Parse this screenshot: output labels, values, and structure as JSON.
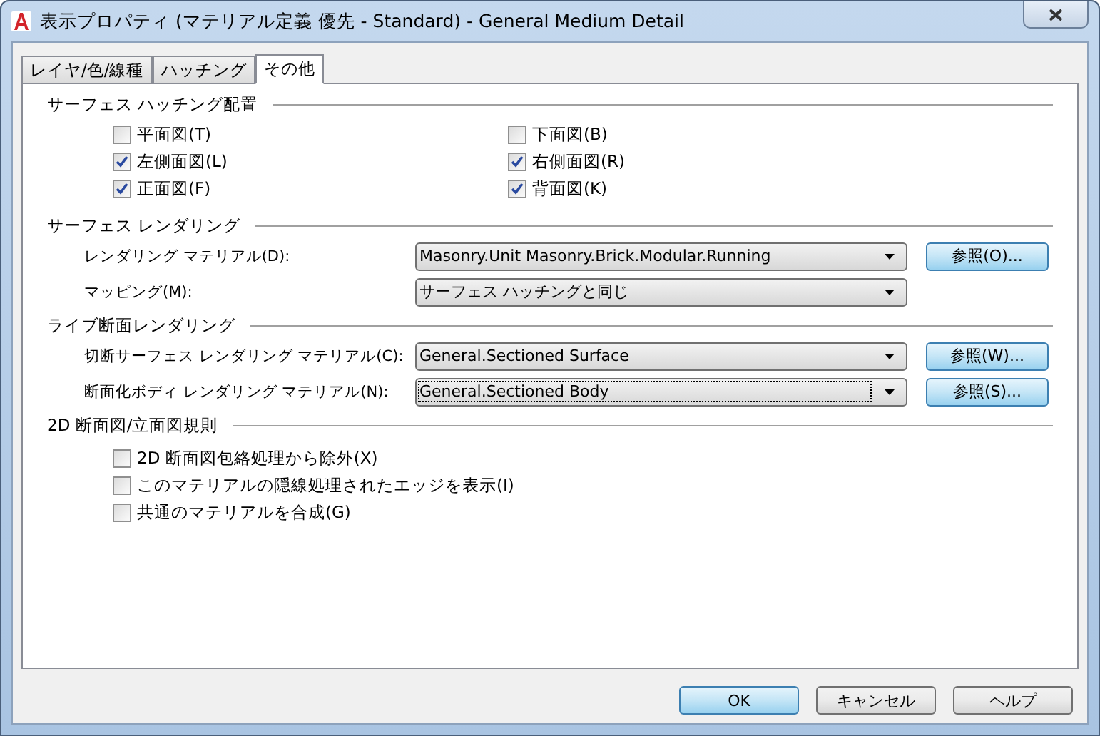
{
  "window": {
    "title": "表示プロパティ (マテリアル定義 優先 - Standard) - General Medium Detail"
  },
  "tabs": [
    {
      "label": "レイヤ/色/線種",
      "selected": false
    },
    {
      "label": "ハッチング",
      "selected": false
    },
    {
      "label": "その他",
      "selected": true
    }
  ],
  "sections": [
    {
      "title": "サーフェス ハッチング配置",
      "kind": "grid",
      "checkboxes": [
        {
          "label": "平面図(T)",
          "checked": false
        },
        {
          "label": "下面図(B)",
          "checked": false
        },
        {
          "label": "左側面図(L)",
          "checked": true
        },
        {
          "label": "右側面図(R)",
          "checked": true
        },
        {
          "label": "正面図(F)",
          "checked": true
        },
        {
          "label": "背面図(K)",
          "checked": true
        }
      ]
    },
    {
      "title": "サーフェス レンダリング",
      "kind": "combos",
      "rows": [
        {
          "label": "レンダリング マテリアル(D):",
          "value": "Masonry.Unit Masonry.Brick.Modular.Running",
          "button": "参照(O)...",
          "focused": false
        },
        {
          "label": "マッピング(M):",
          "value": "サーフェス ハッチングと同じ",
          "focused": false
        }
      ]
    },
    {
      "title": "ライブ断面レンダリング",
      "kind": "combos",
      "rows": [
        {
          "label": "切断サーフェス レンダリング マテリアル(C):",
          "value": "General.Sectioned Surface",
          "button": "参照(W)...",
          "focused": false
        },
        {
          "label": "断面化ボディ レンダリング マテリアル(N):",
          "value": "General.Sectioned Body",
          "button": "参照(S)...",
          "focused": true
        }
      ]
    },
    {
      "title": "2D 断面図/立面図規則",
      "kind": "list",
      "checkboxes": [
        {
          "label": "2D 断面図包絡処理から除外(X)",
          "checked": false
        },
        {
          "label": "このマテリアルの隠線処理されたエッジを表示(I)",
          "checked": false
        },
        {
          "label": "共通のマテリアルを合成(G)",
          "checked": false
        }
      ]
    }
  ],
  "buttons": [
    {
      "label": "OK",
      "default": true
    },
    {
      "label": "キャンセル",
      "default": false
    },
    {
      "label": "ヘルプ",
      "default": false
    }
  ]
}
